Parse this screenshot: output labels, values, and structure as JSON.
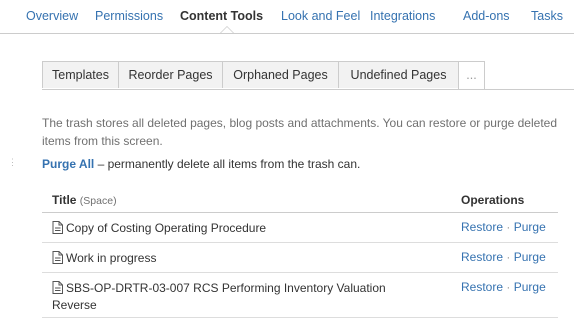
{
  "nav": {
    "items": [
      "Overview",
      "Permissions",
      "Content Tools",
      "Look and Feel",
      "Integrations",
      "Add-ons",
      "Tasks"
    ],
    "active": "Content Tools"
  },
  "subtabs": [
    "Templates",
    "Reorder Pages",
    "Orphaned Pages",
    "Undefined Pages",
    "..."
  ],
  "description": "The trash stores all deleted pages, blog posts and attachments. You can restore or purge deleted items from this screen.",
  "purge": {
    "link": "Purge All",
    "text": " – permanently delete all items from the trash can."
  },
  "table": {
    "title_header": "Title",
    "space_header": "(Space)",
    "ops_header": "Operations",
    "restore_label": "Restore",
    "separator": "·",
    "purge_label": "Purge",
    "rows": [
      "Copy of Costing Operating Procedure",
      "Work in progress",
      "SBS-OP-DRTR-03-007 RCS Performing Inventory Valuation Reverse"
    ]
  },
  "colors": {
    "link": "#3572b0",
    "text": "#333333",
    "muted": "#707070",
    "border": "#cccccc"
  },
  "icons": {
    "page": "page-icon"
  }
}
